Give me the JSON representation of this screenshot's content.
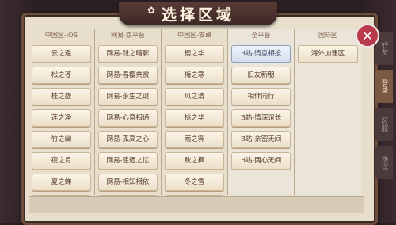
{
  "title": "选择区域",
  "columns": [
    {
      "header": "中国区-iOS",
      "servers": [
        "云之遥",
        "松之苍",
        "桂之馥",
        "莲之净",
        "竹之幽",
        "夜之月",
        "夏之蝉",
        ""
      ]
    },
    {
      "header": "网易-双平台",
      "servers": [
        "网易-谜之暗影",
        "网易-春樱共赏",
        "网易-永生之谜",
        "网易-心意相通",
        "网易-孤高之心",
        "网易-遥远之忆",
        "网易-相知相依",
        ""
      ]
    },
    {
      "header": "中国区-安卓",
      "servers": [
        "樱之华",
        "梅之寒",
        "风之清",
        "桃之华",
        "雨之霁",
        "秋之枫",
        "冬之雪",
        ""
      ]
    },
    {
      "header": "全平台",
      "servers": [
        "B站-情意相投",
        "旧友新朋",
        "相伴同行",
        "B站-情深谊长",
        "B站-亲密无间",
        "B站-两心无间"
      ]
    },
    {
      "header": "国际区",
      "servers": [
        "海外加速区"
      ]
    }
  ],
  "selected_server": "B站-情意相投",
  "side_tabs": [
    "好友",
    "登录",
    "区服",
    "协议"
  ]
}
